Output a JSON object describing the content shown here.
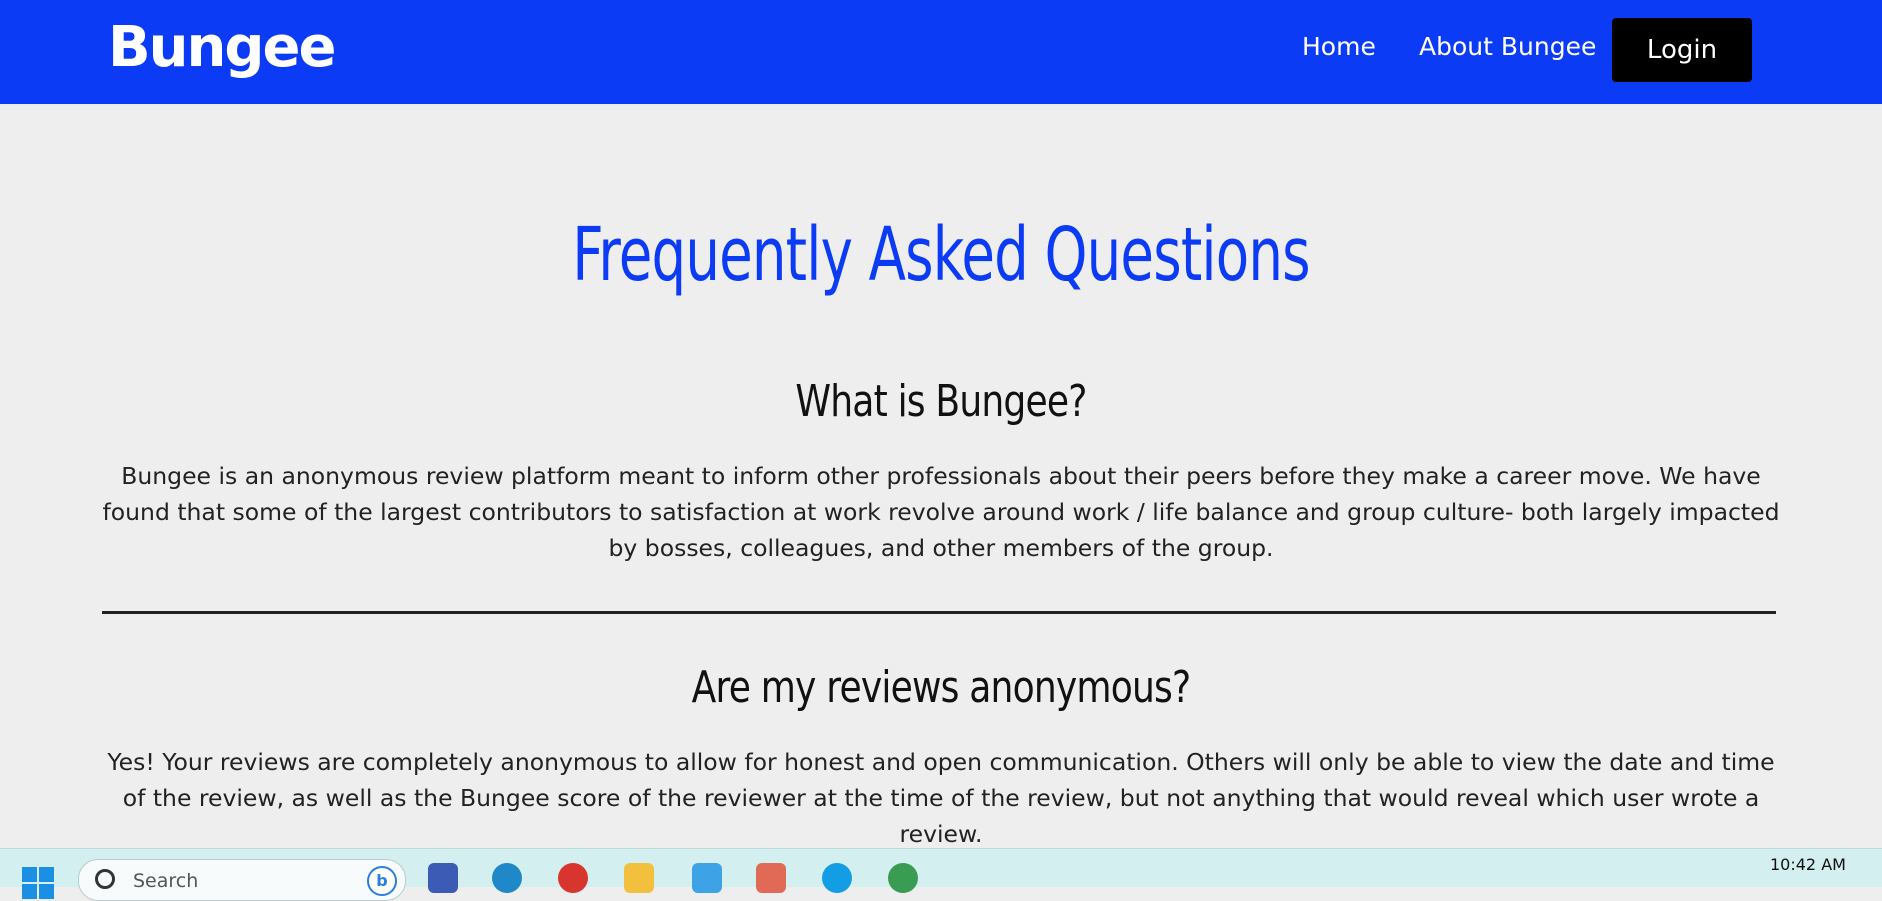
{
  "header": {
    "brand": "Bungee",
    "nav": [
      {
        "label": "Home"
      },
      {
        "label": "About Bungee"
      }
    ],
    "login_label": "Login"
  },
  "faq": {
    "title": "Frequently Asked Questions",
    "items": [
      {
        "question": "What is Bungee?",
        "answer": "Bungee is an anonymous review platform meant to inform other professionals about their peers before they make a career move. We have found that some of the largest contributors to satisfaction at work revolve around work / life balance and group culture- both largely impacted by bosses, colleagues, and other members of the group."
      },
      {
        "question": "Are my reviews anonymous?",
        "answer": "Yes! Your reviews are completely anonymous to allow for honest and open communication. Others will only be able to view the date and time of the review, as well as the Bungee score of the reviewer at the time of the review, but not anything that would reveal which user wrote a review."
      }
    ]
  },
  "taskbar": {
    "search_placeholder": "Search",
    "clock": "10:42 AM",
    "apps": [
      "terminal-icon",
      "edge-icon",
      "chrome-icon",
      "folder-icon",
      "notepad-icon",
      "office-icon",
      "skype-icon",
      "chrome-dev-icon"
    ]
  },
  "colors": {
    "brand_blue": "#0c3bf6",
    "page_bg": "#eeeeee",
    "login_bg": "#000000"
  }
}
